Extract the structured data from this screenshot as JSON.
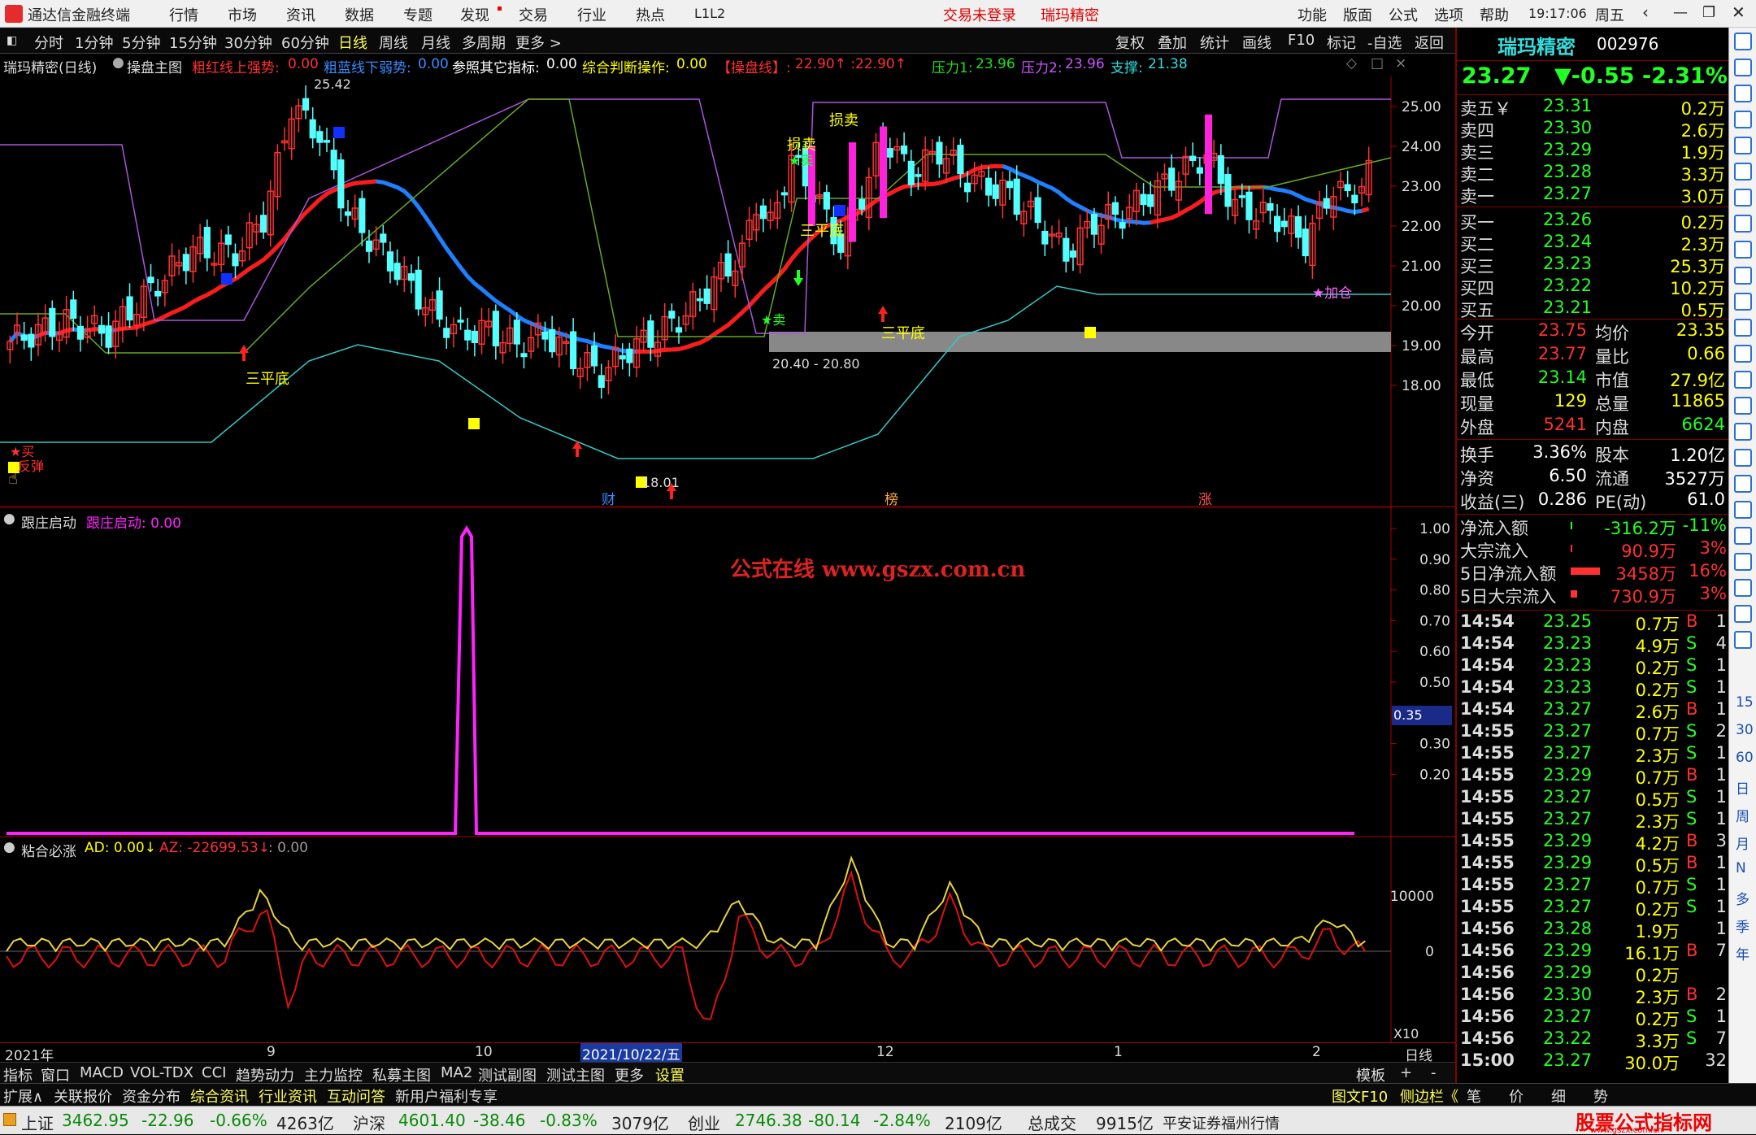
{
  "app": {
    "title": "通达信金融终端",
    "menu": [
      "行情",
      "市场",
      "资讯",
      "数据",
      "专题",
      "发现",
      "交易",
      "行业",
      "热点",
      "L1L2"
    ],
    "login_status": "交易未登录",
    "stock_label": "瑞玛精密",
    "right_menu": [
      "功能",
      "版面",
      "公式",
      "选项",
      "帮助"
    ],
    "clock": "19:17:06",
    "weekday": "周五"
  },
  "periods": [
    "分时",
    "1分钟",
    "5分钟",
    "15分钟",
    "30分钟",
    "60分钟",
    "日线",
    "周线",
    "月线",
    "多周期",
    "更多 >"
  ],
  "active_period": "日线",
  "right_tools": [
    "复权",
    "叠加",
    "统计",
    "画线",
    "F10",
    "标记",
    "-自选",
    "返回"
  ],
  "info": {
    "name": "瑞玛精密(日线)",
    "main_formula": "操盘主图",
    "items": [
      {
        "label": "粗红线上强势:",
        "value": "0.00",
        "color": "#ff3030"
      },
      {
        "label": "粗蓝线下弱势:",
        "value": "0.00",
        "color": "#3a8bff"
      },
      {
        "label": "参照其它指标:",
        "value": "0.00",
        "color": "#ffffff"
      },
      {
        "label": "综合判断操作:",
        "value": "0.00",
        "color": "#ffff00"
      },
      {
        "label": "【操盘线】:",
        "value": "22.90↑ :22.90↑",
        "color": "#ff3030"
      },
      {
        "label": "压力1:",
        "value": "23.96",
        "color": "#22dd22"
      },
      {
        "label": "压力2:",
        "value": "23.96",
        "color": "#cc55ff"
      },
      {
        "label": "支撑:",
        "value": "21.38",
        "color": "#33dddd"
      }
    ]
  },
  "main_chart": {
    "y_ticks": [
      "25.00",
      "24.00",
      "23.00",
      "22.00",
      "21.00",
      "20.00",
      "19.00",
      "18.00"
    ],
    "annotations": {
      "high": "25.42",
      "low": "18.01",
      "zone": "20.40 - 20.80",
      "sanpingdi_1": "三平底",
      "sanpingdi_2": "三平底",
      "sanpingdi_3": "三平底",
      "sell_1": "★卖",
      "sell_2": "★卖",
      "buy": "★买",
      "rebound": "反弹",
      "stop_loss_1": "损卖",
      "stop_loss_2": "损卖",
      "add": "★加仓",
      "cai": "财",
      "bang": "榜",
      "zhang": "涨"
    },
    "colors": {
      "up": "#ff3232",
      "down": "#54ffff",
      "red_line": "#ff1a1a",
      "blue_line": "#1e7fff",
      "support": "#33c9c9",
      "pressure1": "#66aa22",
      "pressure2": "#aa55dd"
    }
  },
  "panel2": {
    "name": "跟庄启动",
    "value_label": "跟庄启动: 0.00",
    "watermark": "公式在线  www.gszx.com.cn",
    "y_ticks": [
      "1.00",
      "0.90",
      "0.80",
      "0.70",
      "0.60",
      "0.50",
      "0.30",
      "0.20"
    ],
    "cursor_value": "0.35"
  },
  "panel3": {
    "name": "粘合必涨",
    "ad_label": "AD: 0.00↓",
    "az_label": "AZ: -22699.53↓",
    "extra_label": ": 0.00",
    "y_ticks": [
      "10000",
      "0"
    ],
    "x10": "X10"
  },
  "x_axis": {
    "labels": [
      "2021年",
      "9",
      "10",
      "2021/10/22/五",
      "11",
      "12",
      "1",
      "2"
    ],
    "right": "日线"
  },
  "tabs": [
    "指标",
    "窗口",
    "MACD",
    "VOL-TDX",
    "CCI",
    "趋势动力",
    "主力监控",
    "私募主图",
    "MA2",
    "测试副图",
    "测试主图",
    "更多",
    "设置"
  ],
  "tabs_right": [
    "模板",
    "+",
    "-"
  ],
  "tabs2": [
    "扩展∧",
    "关联报价",
    "资金分布",
    "综合资讯",
    "行业资讯",
    "互动问答",
    "新用户福利专享"
  ],
  "tabs2_right": [
    "图文F10",
    "侧边栏《",
    "笔",
    "价",
    "细",
    "势"
  ],
  "quote": {
    "name": "瑞玛精密",
    "code": "002976",
    "price": "23.27",
    "change": "▼-0.55",
    "pct": "-2.31%",
    "sells": [
      {
        "label": "卖五￥",
        "price": "23.31",
        "vol": "0.2万"
      },
      {
        "label": "卖四",
        "price": "23.30",
        "vol": "2.6万"
      },
      {
        "label": "卖三",
        "price": "23.29",
        "vol": "1.9万"
      },
      {
        "label": "卖二",
        "price": "23.28",
        "vol": "3.3万"
      },
      {
        "label": "卖一",
        "price": "23.27",
        "vol": "3.0万"
      }
    ],
    "buys": [
      {
        "label": "买一",
        "price": "23.26",
        "vol": "0.2万"
      },
      {
        "label": "买二",
        "price": "23.24",
        "vol": "2.3万"
      },
      {
        "label": "买三",
        "price": "23.23",
        "vol": "25.3万"
      },
      {
        "label": "买四",
        "price": "23.22",
        "vol": "10.2万"
      },
      {
        "label": "买五",
        "price": "23.21",
        "vol": "0.5万"
      }
    ],
    "stats": [
      {
        "l1": "今开",
        "v1": "23.75",
        "l2": "均价",
        "v2": "23.35",
        "c1": "#ff3030",
        "c2": "#ffff00"
      },
      {
        "l1": "最高",
        "v1": "23.77",
        "l2": "量比",
        "v2": "0.66",
        "c1": "#ff3030",
        "c2": "#ffff00"
      },
      {
        "l1": "最低",
        "v1": "23.14",
        "l2": "市值",
        "v2": "27.9亿",
        "c1": "#22ff22",
        "c2": "#ffff00"
      },
      {
        "l1": "现量",
        "v1": "129",
        "l2": "总量",
        "v2": "11865",
        "c1": "#ffff00",
        "c2": "#ffff00"
      },
      {
        "l1": "外盘",
        "v1": "5241",
        "l2": "内盘",
        "v2": "6624",
        "c1": "#ff3030",
        "c2": "#22ff22"
      }
    ],
    "stats2": [
      {
        "l1": "换手",
        "v1": "3.36%",
        "l2": "股本",
        "v2": "1.20亿"
      },
      {
        "l1": "净资",
        "v1": "6.50",
        "l2": "流通",
        "v2": "3527万"
      },
      {
        "l1": "收益(三)",
        "v1": "0.286",
        "l2": "PE(动)",
        "v2": "61.0"
      }
    ],
    "flows": [
      {
        "label": "净流入额",
        "value": "-316.2万",
        "pct": "-11%",
        "color": "#22ff22",
        "bar": 2
      },
      {
        "label": "大宗流入",
        "value": "90.9万",
        "pct": "3%",
        "color": "#ff3030",
        "bar": 2
      },
      {
        "label": "5日净流入额",
        "value": "3458万",
        "pct": "16%",
        "color": "#ff3030",
        "bar": 36
      },
      {
        "label": "5日大宗流入",
        "value": "730.9万",
        "pct": "3%",
        "color": "#ff3030",
        "bar": 8
      }
    ],
    "ticks": [
      {
        "t": "14:54",
        "p": "23.25",
        "v": "0.7万",
        "s": "B",
        "n": "1"
      },
      {
        "t": "14:54",
        "p": "23.23",
        "v": "4.9万",
        "s": "S",
        "n": "4"
      },
      {
        "t": "14:54",
        "p": "23.23",
        "v": "0.2万",
        "s": "S",
        "n": "1"
      },
      {
        "t": "14:54",
        "p": "23.23",
        "v": "0.2万",
        "s": "S",
        "n": "1"
      },
      {
        "t": "14:54",
        "p": "23.27",
        "v": "2.6万",
        "s": "B",
        "n": "1"
      },
      {
        "t": "14:55",
        "p": "23.27",
        "v": "0.7万",
        "s": "S",
        "n": "2"
      },
      {
        "t": "14:55",
        "p": "23.27",
        "v": "2.3万",
        "s": "S",
        "n": "1"
      },
      {
        "t": "14:55",
        "p": "23.29",
        "v": "0.7万",
        "s": "B",
        "n": "1"
      },
      {
        "t": "14:55",
        "p": "23.27",
        "v": "0.5万",
        "s": "S",
        "n": "1"
      },
      {
        "t": "14:55",
        "p": "23.27",
        "v": "2.3万",
        "s": "S",
        "n": "1"
      },
      {
        "t": "14:55",
        "p": "23.29",
        "v": "4.2万",
        "s": "B",
        "n": "3"
      },
      {
        "t": "14:55",
        "p": "23.29",
        "v": "0.5万",
        "s": "B",
        "n": "1"
      },
      {
        "t": "14:55",
        "p": "23.27",
        "v": "0.7万",
        "s": "S",
        "n": "1"
      },
      {
        "t": "14:55",
        "p": "23.27",
        "v": "0.2万",
        "s": "S",
        "n": "1"
      },
      {
        "t": "14:56",
        "p": "23.28",
        "v": "1.9万",
        "s": "",
        "n": "1"
      },
      {
        "t": "14:56",
        "p": "23.29",
        "v": "16.1万",
        "s": "B",
        "n": "7"
      },
      {
        "t": "14:56",
        "p": "23.29",
        "v": "0.2万",
        "s": "",
        "n": ""
      },
      {
        "t": "14:56",
        "p": "23.30",
        "v": "2.3万",
        "s": "B",
        "n": "2"
      },
      {
        "t": "14:56",
        "p": "23.27",
        "v": "0.2万",
        "s": "S",
        "n": "1"
      },
      {
        "t": "14:56",
        "p": "23.22",
        "v": "3.3万",
        "s": "S",
        "n": "7"
      },
      {
        "t": "15:00",
        "p": "23.27",
        "v": "30.0万",
        "s": "",
        "n": "32"
      }
    ]
  },
  "sidebar_labels": [
    "15",
    "30",
    "60",
    "日",
    "周",
    "月",
    "N",
    "多",
    "季",
    "年"
  ],
  "status": {
    "indices": [
      {
        "name": "上证",
        "value": "3462.95",
        "chg": "-22.96",
        "pct": "-0.66%",
        "amt": "4263亿"
      },
      {
        "name": "沪深",
        "value": "4601.40",
        "chg": "-38.46",
        "pct": "-0.83%",
        "amt": "3079亿"
      },
      {
        "name": "创业",
        "value": "2746.38",
        "chg": "-80.14",
        "pct": "-2.84%",
        "amt": "2109亿"
      }
    ],
    "total_label": "总成交",
    "total_value": "9915亿",
    "broker": "平安证券福州行情",
    "brand": "股票公式指标网",
    "brand_url": "www.gszx.com.cn"
  }
}
